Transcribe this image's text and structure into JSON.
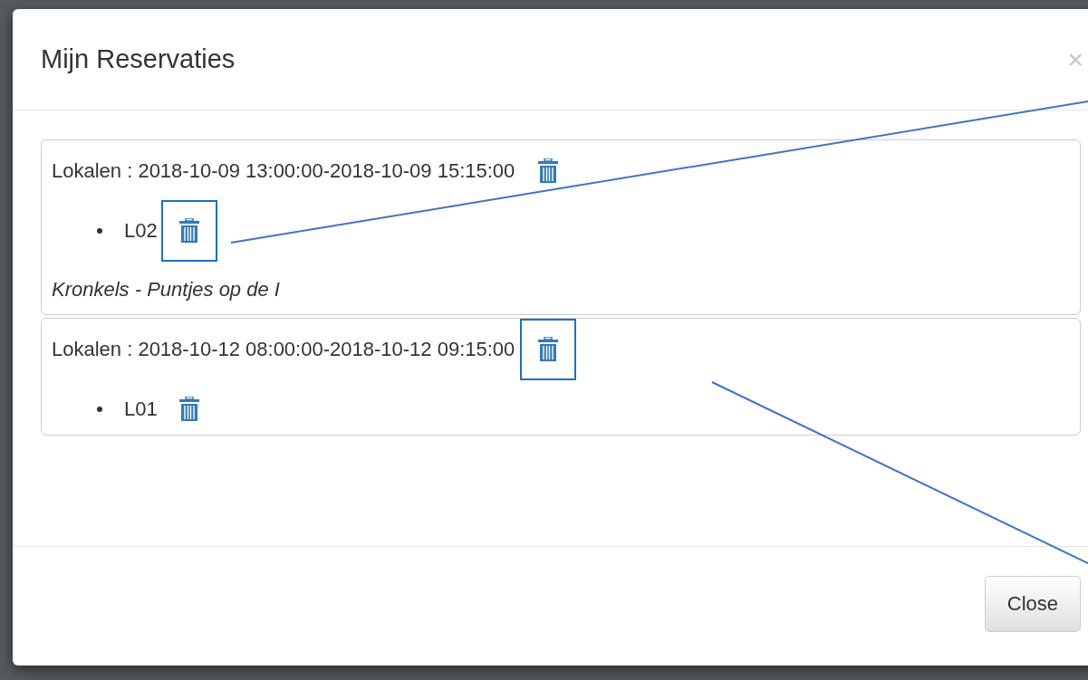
{
  "modal": {
    "title": "Mijn Reservaties",
    "close_icon": "×",
    "reservations": [
      {
        "heading": "Lokalen : 2018-10-09 13:00:00-2018-10-09 15:15:00",
        "highlighted": false,
        "rooms": [
          {
            "name": "L02",
            "highlighted": true
          }
        ],
        "note": "Kronkels - Puntjes op de I"
      },
      {
        "heading": "Lokalen : 2018-10-12 08:00:00-2018-10-12 09:15:00",
        "highlighted": true,
        "rooms": [
          {
            "name": "L01",
            "highlighted": false
          }
        ]
      }
    ],
    "footer_button": "Close"
  }
}
